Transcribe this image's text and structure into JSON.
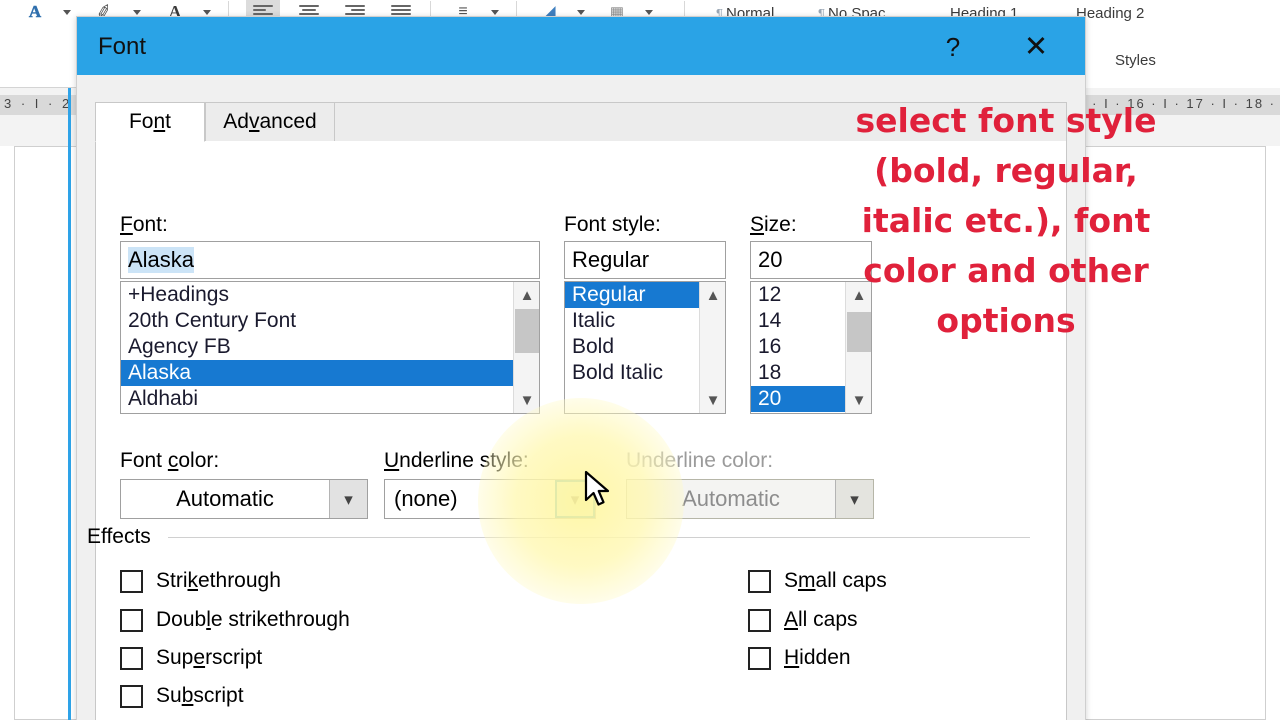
{
  "ribbon": {
    "icons": [
      {
        "name": "text-effects-icon",
        "glyph": "A"
      },
      {
        "name": "text-highlight-color-icon",
        "glyph": "✐"
      },
      {
        "name": "font-color-icon",
        "glyph": "A"
      },
      {
        "name": "align-left-icon",
        "glyph": "align"
      },
      {
        "name": "align-center-icon",
        "glyph": "align"
      },
      {
        "name": "align-right-icon",
        "glyph": "align"
      },
      {
        "name": "justify-icon",
        "glyph": "align"
      },
      {
        "name": "line-spacing-icon",
        "glyph": "≡"
      },
      {
        "name": "shading-icon",
        "glyph": "◢"
      },
      {
        "name": "borders-icon",
        "glyph": "▦"
      }
    ],
    "styles": [
      {
        "label": "Normal",
        "mark": "¶"
      },
      {
        "label": "No Spac...",
        "mark": "¶"
      },
      {
        "label": "Heading 1",
        "mark": ""
      },
      {
        "label": "Heading 2",
        "mark": ""
      }
    ],
    "styles_group_label": "Styles"
  },
  "ruler": {
    "left_ticks": "3 · I · 2",
    "right_ticks": "· I · 16 ·  I  · 17 ·  I  · 18 ·"
  },
  "dialog": {
    "title": "Font",
    "help_label": "?",
    "close_label": "✕",
    "tabs": [
      {
        "label_before": "Fo",
        "label_accel": "n",
        "label_after": "t",
        "active": true
      },
      {
        "label_before": "Ad",
        "label_accel": "v",
        "label_after": "anced",
        "active": false
      }
    ],
    "font_section": {
      "label_before": "",
      "label_accel": "F",
      "label_after": "ont:",
      "input_value": "Alaska",
      "items": [
        "+Headings",
        "20th Century Font",
        "Agency FB",
        "Alaska",
        "Aldhabi"
      ],
      "selected": "Alaska"
    },
    "style_section": {
      "label": "Font style:",
      "input_value": "Regular",
      "items": [
        "Regular",
        "Italic",
        "Bold",
        "Bold Italic"
      ],
      "selected": "Regular"
    },
    "size_section": {
      "label_accel": "S",
      "label_after": "ize:",
      "input_value": "20",
      "items": [
        "12",
        "14",
        "16",
        "18",
        "20"
      ],
      "selected": "20"
    },
    "font_color": {
      "label_before": "Font ",
      "label_accel": "c",
      "label_after": "olor:",
      "value": "Automatic",
      "disabled": false
    },
    "underline_style": {
      "label_accel": "U",
      "label_after": "nderline style:",
      "value": "(none)",
      "disabled": false,
      "arrow_hovered": true
    },
    "underline_color": {
      "label": "Underline color:",
      "value": "Automatic",
      "disabled": true
    },
    "effects": {
      "group_label": "Effects",
      "left": [
        {
          "before": "Stri",
          "accel": "k",
          "after": "ethrough",
          "checked": false
        },
        {
          "before": "Doub",
          "accel": "l",
          "after": "e strikethrough",
          "checked": false
        },
        {
          "before": "Sup",
          "accel": "e",
          "after": "rscript",
          "checked": false
        },
        {
          "before": "Su",
          "accel": "b",
          "after": "script",
          "checked": false
        }
      ],
      "right": [
        {
          "before": "S",
          "accel": "m",
          "after": "all caps",
          "checked": false
        },
        {
          "before": "",
          "accel": "A",
          "after": "ll caps",
          "checked": false
        },
        {
          "before": "",
          "accel": "H",
          "after": "idden",
          "checked": false
        }
      ]
    }
  },
  "annotation": {
    "text": "select font style (bold, regular, italic etc.), font color and other options",
    "color": "#e0213b"
  },
  "colors": {
    "titlebar": "#2aa3e6",
    "selection_blue": "#1779d1",
    "input_selection": "#cce4f7",
    "hover_border": "#1a8fc0",
    "hover_fill": "#dff0e4",
    "page_edge": "#2ea3e8",
    "highlight_glow": "#fff6a0"
  }
}
